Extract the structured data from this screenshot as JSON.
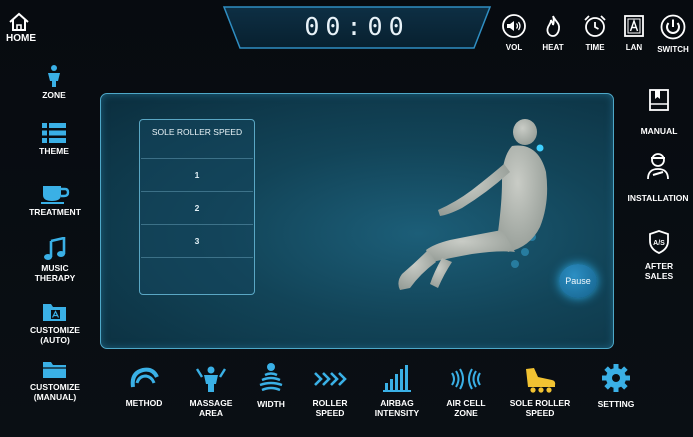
{
  "header": {
    "home_label": "HOME",
    "timer": "00:00"
  },
  "top_controls": [
    {
      "label": "VOL",
      "icon": "speaker-icon"
    },
    {
      "label": "HEAT",
      "icon": "flame-icon"
    },
    {
      "label": "TIME",
      "icon": "alarm-clock-icon"
    },
    {
      "label": "LAN",
      "icon": "language-icon"
    },
    {
      "label": "SWITCH",
      "icon": "power-icon"
    }
  ],
  "left_sidebar": [
    {
      "label": "ZONE",
      "icon": "body-zone-icon"
    },
    {
      "label": "THEME",
      "icon": "list-icon"
    },
    {
      "label": "TREATMENT",
      "icon": "cup-icon"
    },
    {
      "label": "MUSIC THERAPY",
      "line1": "MUSIC",
      "line2": "THERAPY",
      "icon": "music-note-icon"
    },
    {
      "label": "CUSTOMIZE (AUTO)",
      "line1": "CUSTOMIZE",
      "line2": "(AUTO)",
      "icon": "folder-auto-icon"
    },
    {
      "label": "CUSTOMIZE (MANUAL)",
      "line1": "CUSTOMIZE",
      "line2": "(MANUAL)",
      "icon": "folder-manual-icon"
    }
  ],
  "right_sidebar": [
    {
      "label": "MANUAL",
      "icon": "book-icon"
    },
    {
      "label": "INSTALLATION",
      "icon": "technician-icon"
    },
    {
      "label": "AFTER SALES",
      "line1": "AFTER",
      "line2": "SALES",
      "icon": "after-sales-shield-icon"
    }
  ],
  "panel": {
    "speed_title": "SOLE ROLLER SPEED",
    "speed_options": [
      "1",
      "2",
      "3"
    ],
    "pause_label": "Pause"
  },
  "bottom_bar": [
    {
      "label": "METHOD",
      "icon": "method-icon"
    },
    {
      "label": "MASSAGE AREA",
      "line1": "MASSAGE",
      "line2": "AREA",
      "icon": "massage-area-icon"
    },
    {
      "label": "WIDTH",
      "icon": "width-icon"
    },
    {
      "label": "ROLLER SPEED",
      "line1": "ROLLER",
      "line2": "SPEED",
      "icon": "roller-speed-icon"
    },
    {
      "label": "AIRBAG INTENSITY",
      "line1": "AIRBAG",
      "line2": "INTENSITY",
      "icon": "airbag-intensity-icon"
    },
    {
      "label": "AIR CELL ZONE",
      "line1": "AIR CELL",
      "line2": "ZONE",
      "icon": "air-cell-icon"
    },
    {
      "label": "SOLE ROLLER SPEED",
      "line1": "SOLE ROLLER",
      "line2": "SPEED",
      "icon": "sole-roller-icon"
    },
    {
      "label": "SETTING",
      "icon": "gear-icon"
    }
  ],
  "colors": {
    "accent": "#3ab0e6",
    "panel": "#124458",
    "highlight": "#f1c232"
  }
}
